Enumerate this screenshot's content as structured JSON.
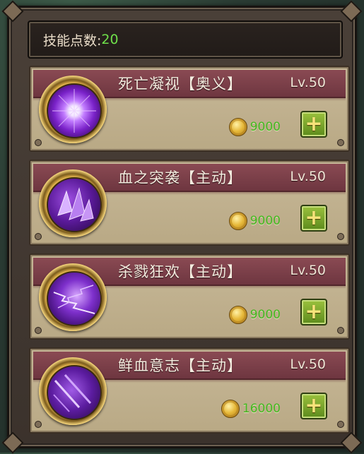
{
  "skill_points": {
    "label": "技能点数:",
    "value": "20"
  },
  "skills": [
    {
      "name": "死亡凝视【奥义】",
      "level": "Lv.50",
      "cost": "9000",
      "icon": "death-gaze-orb-icon",
      "upgrade": "+"
    },
    {
      "name": "血之突袭【主动】",
      "level": "Lv.50",
      "cost": "9000",
      "icon": "blood-assault-crystal-icon",
      "upgrade": "+"
    },
    {
      "name": "杀戮狂欢【主动】",
      "level": "Lv.50",
      "cost": "9000",
      "icon": "carnage-lightning-icon",
      "upgrade": "+"
    },
    {
      "name": "鲜血意志【主动】",
      "level": "Lv.50",
      "cost": "16000",
      "icon": "blood-will-slash-icon",
      "upgrade": "+"
    }
  ],
  "colors": {
    "points_value": "#6fe04a",
    "cost": "#43b81f",
    "header": "#7c3f48",
    "panel": "#c2b392"
  }
}
